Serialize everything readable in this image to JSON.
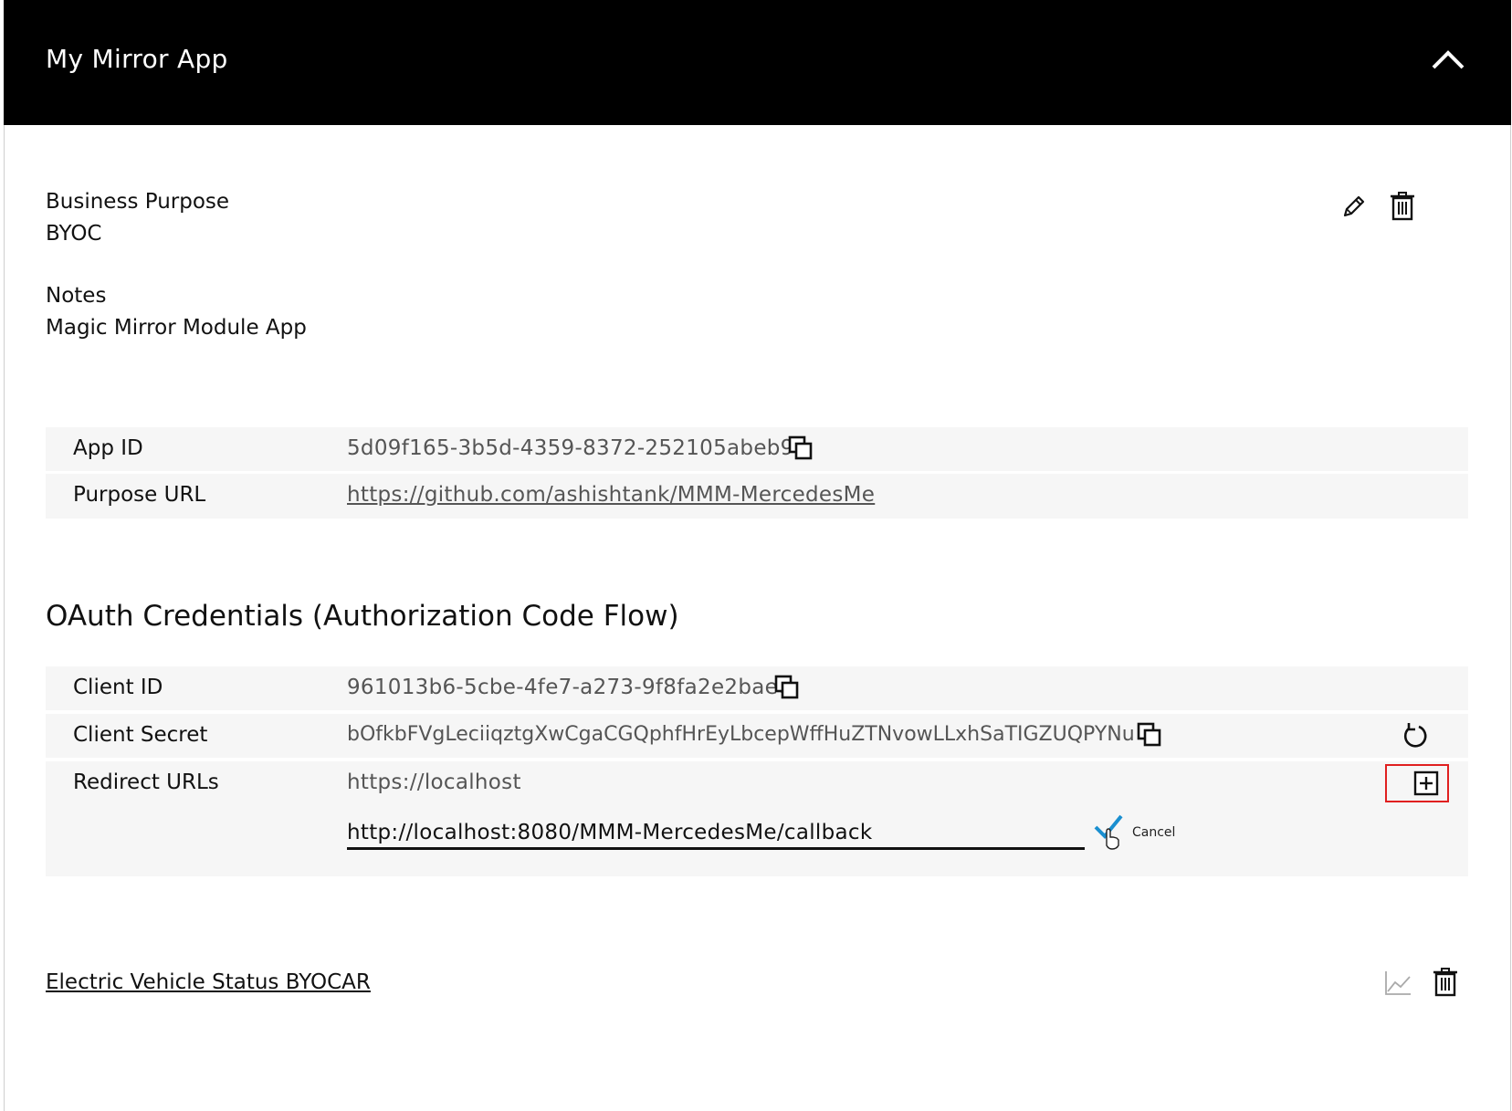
{
  "header": {
    "title": "My Mirror App",
    "collapse_icon": "chevron-up-icon"
  },
  "details": {
    "business_purpose_label": "Business Purpose",
    "business_purpose_value": "BYOC",
    "notes_label": "Notes",
    "notes_value": "Magic Mirror Module App",
    "actions": [
      "pencil-icon",
      "trash-icon"
    ]
  },
  "app_info": {
    "app_id_label": "App ID",
    "app_id_value": "5d09f165-3b5d-4359-8372-252105abeb9f",
    "purpose_url_label": "Purpose URL",
    "purpose_url_value": "https://github.com/ashishtank/MMM-MercedesMe"
  },
  "oauth": {
    "title": "OAuth Credentials (Authorization Code Flow)",
    "client_id_label": "Client ID",
    "client_id_value": "961013b6-5cbe-4fe7-a273-9f8fa2e2baee",
    "client_secret_label": "Client Secret",
    "client_secret_value": "bOfkbFVgLeciiqztgXwCgaCGQphfHrEyLbcepWffHuZTNvowLLxhSaTIGZUQPYNu",
    "redirect_label": "Redirect URLs",
    "redirect_existing": "https://localhost",
    "redirect_input_value": "http://localhost:8080/MMM-MercedesMe/callback",
    "cancel_label": "Cancel",
    "accent_color": "#1a8fd0",
    "highlight_color": "#e02020"
  },
  "product": {
    "link_label": "Electric Vehicle Status BYOCAR",
    "actions": [
      "chart-icon",
      "trash-icon"
    ]
  }
}
